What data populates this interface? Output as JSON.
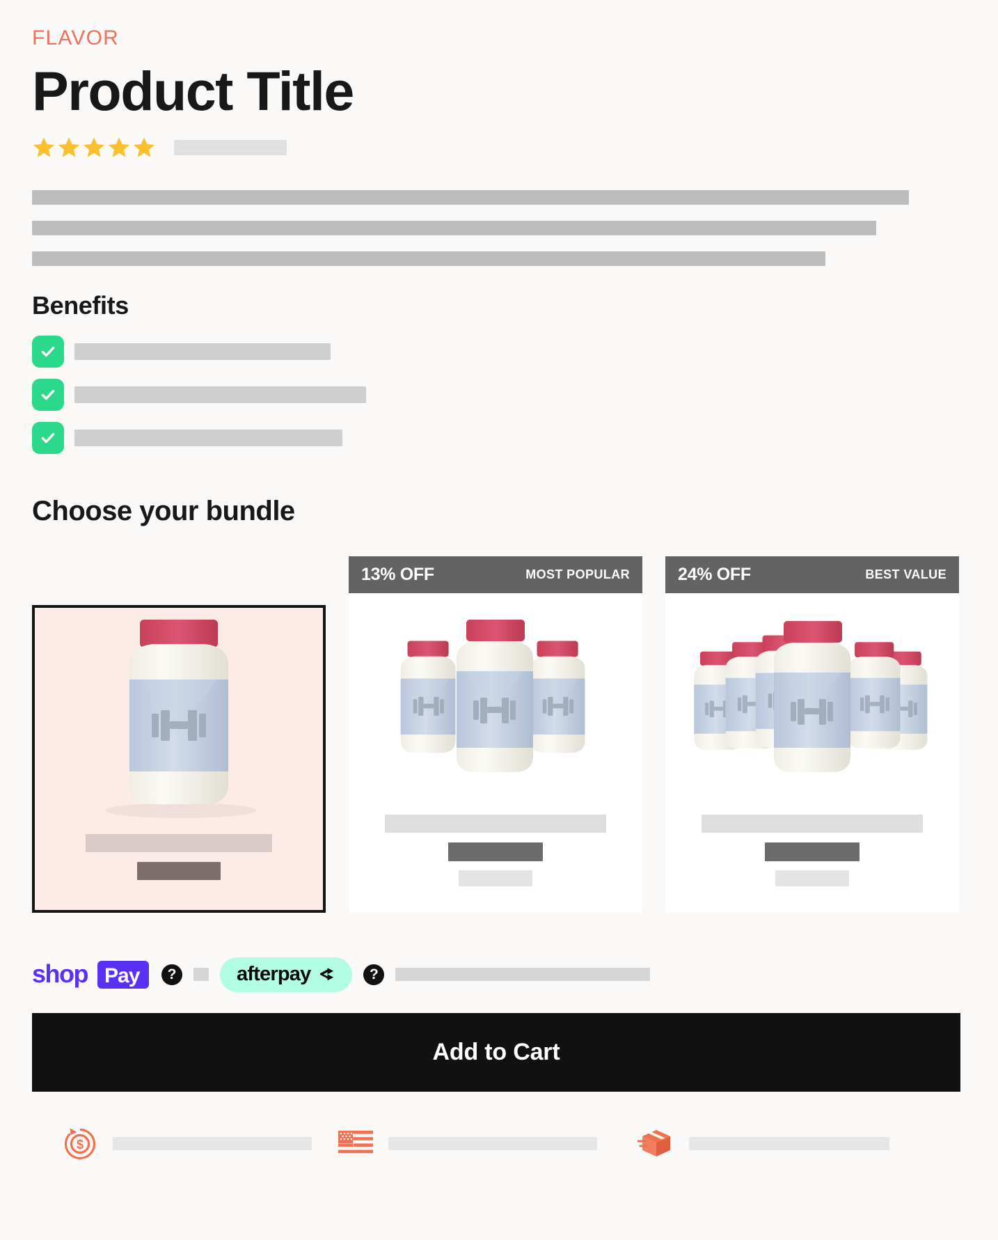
{
  "theme": {
    "background": "#FAF9F7",
    "accent_coral": "#F0705A",
    "accent_green": "#2BD98A",
    "star_gold": "#FBC02D",
    "ribbon_gray": "#636363",
    "cta_black": "#111111",
    "selected_card_bg": "#FCEBE6",
    "shoppay_purple": "#5A31F4",
    "afterpay_mint": "#B2FCE4"
  },
  "header": {
    "eyebrow": "FLAVOR",
    "title": "Product Title",
    "rating": {
      "stars_filled": 5,
      "stars_total": 5,
      "review_count_placeholder": ""
    }
  },
  "description": {
    "lines": [
      "",
      "",
      ""
    ]
  },
  "benefits": {
    "heading": "Benefits",
    "items": [
      {
        "icon": "check-icon",
        "text": ""
      },
      {
        "icon": "check-icon",
        "text": ""
      },
      {
        "icon": "check-icon",
        "text": ""
      }
    ]
  },
  "bundle": {
    "heading": "Choose your bundle",
    "options": [
      {
        "id": "single",
        "selected": true,
        "ribbon_discount": "",
        "ribbon_tag": "",
        "bottles": 1,
        "title_placeholder": "",
        "price_placeholder": ""
      },
      {
        "id": "three-pack",
        "selected": false,
        "ribbon_discount": "13% OFF",
        "ribbon_tag": "MOST POPULAR",
        "bottles": 3,
        "title_placeholder": "",
        "price_placeholder": "",
        "subprice_placeholder": ""
      },
      {
        "id": "six-pack",
        "selected": false,
        "ribbon_discount": "24% OFF",
        "ribbon_tag": "BEST VALUE",
        "bottles": 6,
        "title_placeholder": "",
        "price_placeholder": "",
        "subprice_placeholder": ""
      }
    ]
  },
  "payments": {
    "shop_pay": {
      "word_shop": "shop",
      "word_pay": "Pay"
    },
    "help_icon_glyph": "?",
    "afterpay": {
      "label": "afterpay"
    },
    "installment_text_placeholder": ""
  },
  "cta": {
    "add_to_cart_label": "Add to Cart"
  },
  "trust": {
    "badges": [
      {
        "icon": "money-back-guarantee-icon",
        "text_placeholder": ""
      },
      {
        "icon": "usa-flag-icon",
        "text_placeholder": ""
      },
      {
        "icon": "fast-shipping-box-icon",
        "text_placeholder": ""
      }
    ]
  }
}
